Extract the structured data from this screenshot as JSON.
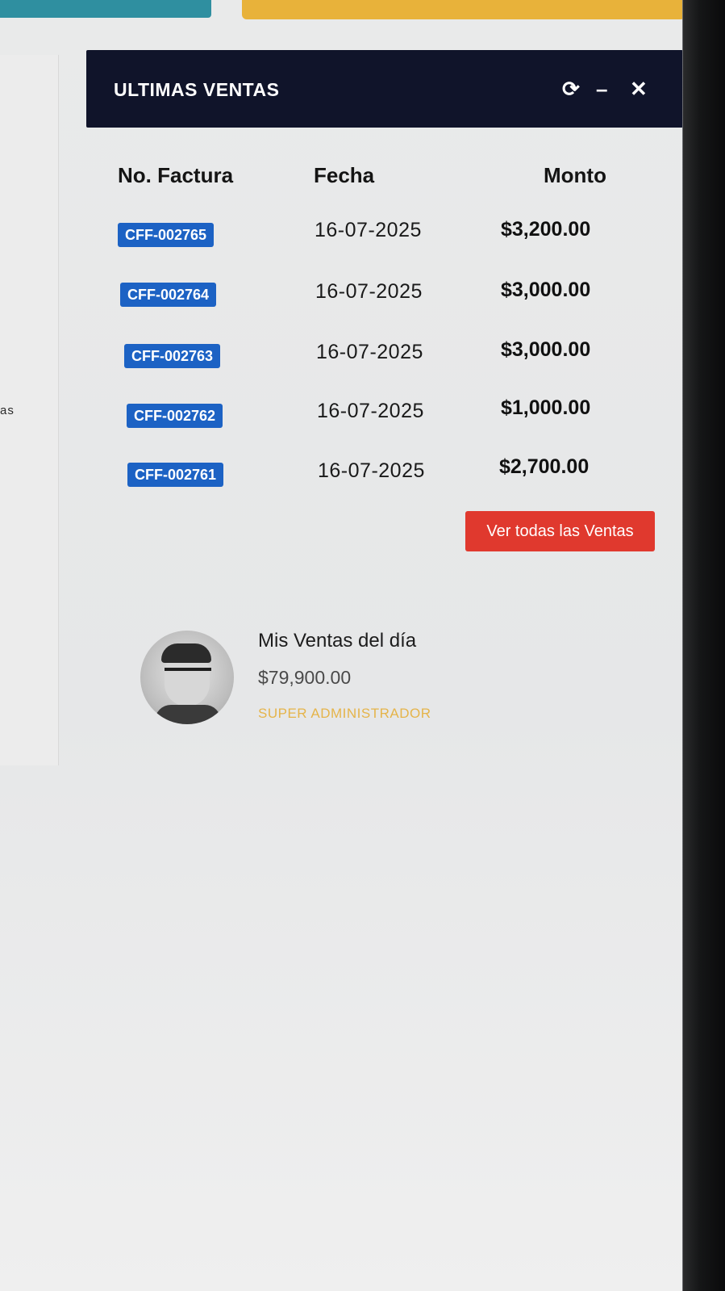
{
  "widget": {
    "title": "ULTIMAS VENTAS",
    "icons": [
      "refresh-icon",
      "minimize-icon",
      "close-icon"
    ]
  },
  "left_fragment": "as",
  "table": {
    "headers": [
      "No. Factura",
      "Fecha",
      "Monto"
    ],
    "rows": [
      {
        "invoice": "CFF-002765",
        "date": "16-07-2025",
        "amount": "$3,200.00"
      },
      {
        "invoice": "CFF-002764",
        "date": "16-07-2025",
        "amount": "$3,000.00"
      },
      {
        "invoice": "CFF-002763",
        "date": "16-07-2025",
        "amount": "$3,000.00"
      },
      {
        "invoice": "CFF-002762",
        "date": "16-07-2025",
        "amount": "$1,000.00"
      },
      {
        "invoice": "CFF-002761",
        "date": "16-07-2025",
        "amount": "$2,700.00"
      }
    ]
  },
  "view_all_label": "Ver todas las Ventas",
  "profile": {
    "title": "Mis Ventas del día",
    "amount": "$79,900.00",
    "role": "SUPER ADMINISTRADOR"
  },
  "colors": {
    "header_bg": "#10142a",
    "badge_bg": "#1c62c4",
    "button_bg": "#e0392e",
    "role_text": "#e5b44a",
    "tile_teal": "#2f8fa0",
    "tile_yellow": "#e8b23a"
  }
}
